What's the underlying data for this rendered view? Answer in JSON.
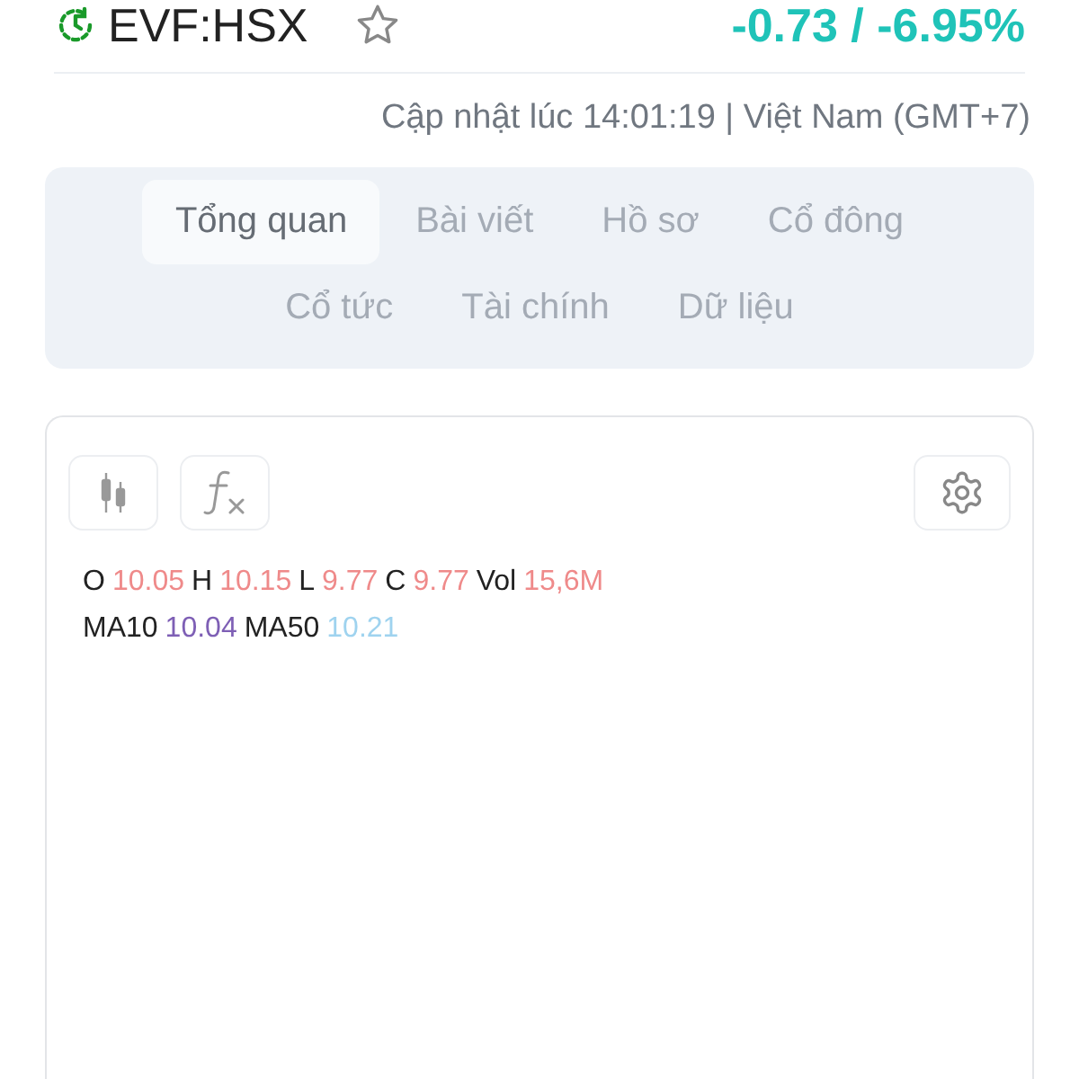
{
  "header": {
    "symbol": "EVF:HSX",
    "favorite": false,
    "change": "-0.73 / -6.95%"
  },
  "updated": "Cập nhật lúc 14:01:19 | Việt Nam (GMT+7)",
  "tabs": [
    {
      "label": "Tổng quan",
      "selected": true
    },
    {
      "label": "Bài viết",
      "selected": false
    },
    {
      "label": "Hồ sơ",
      "selected": false
    },
    {
      "label": "Cổ đông",
      "selected": false
    },
    {
      "label": "Cổ tức",
      "selected": false
    },
    {
      "label": "Tài chính",
      "selected": false
    },
    {
      "label": "Dữ liệu",
      "selected": false
    }
  ],
  "legend": [
    [
      {
        "label": "O",
        "value": "10.05",
        "color": "#ef8a8a"
      },
      {
        "label": "H",
        "value": "10.15",
        "color": "#ef8a8a"
      },
      {
        "label": "L",
        "value": "9.77",
        "color": "#ef8a8a"
      },
      {
        "label": "C",
        "value": "9.77",
        "color": "#ef8a8a"
      },
      {
        "label": "Vol",
        "value": "15,6M",
        "color": "#ef8a8a"
      }
    ],
    [
      {
        "label": "MA10",
        "value": "10.04",
        "color": "#7e5fb5"
      },
      {
        "label": "MA50",
        "value": "10.21",
        "color": "#9fd3ef"
      }
    ]
  ]
}
